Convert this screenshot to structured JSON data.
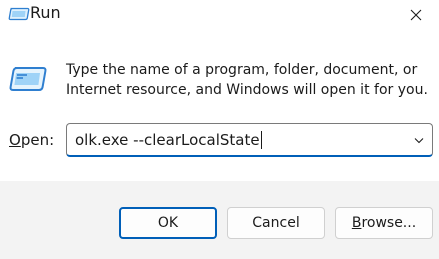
{
  "window": {
    "title": "Run",
    "icon": "run-icon",
    "close_icon": "close-icon"
  },
  "dialog": {
    "description_line1": "Type the name of a program, folder, document, or",
    "description_line2": "Internet resource, and Windows will open it for you.",
    "open_label_mnemonic": "O",
    "open_label_rest": "pen:",
    "open_value": "olk.exe --clearLocalState",
    "dropdown_icon": "chevron-down-icon"
  },
  "buttons": {
    "ok": "OK",
    "cancel": "Cancel",
    "browse_mnemonic": "B",
    "browse_rest": "rowse..."
  },
  "colors": {
    "accent": "#005fb8",
    "footer_bg": "#f3f3f3",
    "icon_blue": "#2f7fd0",
    "icon_light": "#9fd3f7"
  }
}
